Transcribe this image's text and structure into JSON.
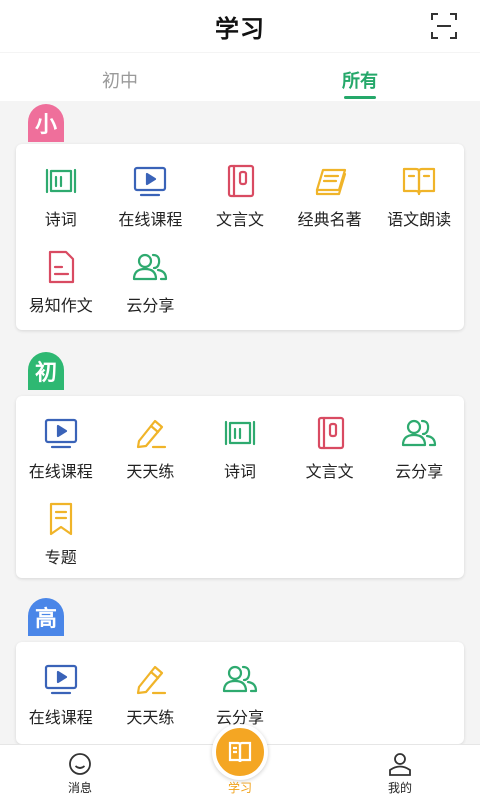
{
  "header": {
    "title": "学习"
  },
  "tabs": [
    {
      "label": "初中",
      "active": false
    },
    {
      "label": "所有",
      "active": true
    }
  ],
  "sections": [
    {
      "badge": "小",
      "badge_color": "#ef6f9b",
      "items": [
        {
          "label": "诗词",
          "icon": "scroll-icon",
          "color": "#2eaa6f"
        },
        {
          "label": "在线课程",
          "icon": "video-play-icon",
          "color": "#3a63b8"
        },
        {
          "label": "文言文",
          "icon": "notebook-icon",
          "color": "#d94b62"
        },
        {
          "label": "经典名著",
          "icon": "stacked-books-icon",
          "color": "#f0b429"
        },
        {
          "label": "语文朗读",
          "icon": "open-book-icon",
          "color": "#f0b429"
        },
        {
          "label": "易知作文",
          "icon": "document-icon",
          "color": "#d94b62"
        },
        {
          "label": "云分享",
          "icon": "users-icon",
          "color": "#2eaa6f"
        }
      ]
    },
    {
      "badge": "初",
      "badge_color": "#2eb872",
      "items": [
        {
          "label": "在线课程",
          "icon": "video-play-icon",
          "color": "#3a63b8"
        },
        {
          "label": "天天练",
          "icon": "pencil-icon",
          "color": "#f0b429"
        },
        {
          "label": "诗词",
          "icon": "scroll-icon",
          "color": "#2eaa6f"
        },
        {
          "label": "文言文",
          "icon": "notebook-icon",
          "color": "#d94b62"
        },
        {
          "label": "云分享",
          "icon": "users-icon",
          "color": "#2eaa6f"
        },
        {
          "label": "专题",
          "icon": "bookmark-icon",
          "color": "#f0b429"
        }
      ]
    },
    {
      "badge": "高",
      "badge_color": "#4a86e8",
      "items": [
        {
          "label": "在线课程",
          "icon": "video-play-icon",
          "color": "#3a63b8"
        },
        {
          "label": "天天练",
          "icon": "pencil-icon",
          "color": "#f0b429"
        },
        {
          "label": "云分享",
          "icon": "users-icon",
          "color": "#2eaa6f"
        }
      ]
    }
  ],
  "bottom_nav": {
    "messages": "消息",
    "study": "学习",
    "mine": "我的"
  },
  "colors": {
    "accent_green": "#25a86a",
    "accent_orange": "#f4a623"
  }
}
